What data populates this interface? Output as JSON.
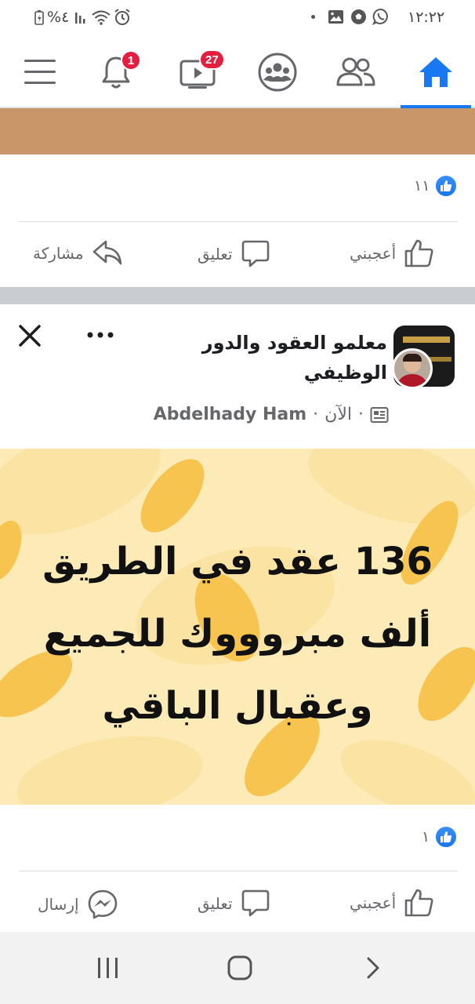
{
  "status_bar": {
    "time": "١٢:٢٢",
    "battery": "%٤",
    "icons": [
      "whatsapp-icon",
      "soccer-icon",
      "gallery-icon",
      "alarm-icon",
      "wifi-icon",
      "signal-icon",
      "battery-icon"
    ]
  },
  "nav": {
    "notifications_badge": "1",
    "video_badge": "27",
    "active_tab": "home",
    "accent": "#1877f2",
    "badge_color": "#e41e3f"
  },
  "post1": {
    "reaction_count": "١١",
    "actions": {
      "like": "أعجبني",
      "comment": "تعليق",
      "share": "مشاركة"
    }
  },
  "post2": {
    "page_name": "معلمو العقود والدور الوظيفي",
    "author": "Abdelhady Ham",
    "time": "الآن",
    "separator": "·",
    "image_text_lines": [
      "136 عقد في الطريق",
      "ألف مبروووك للجميع",
      "وعقبال الباقي"
    ],
    "reaction_count": "١",
    "actions": {
      "like": "أعجبني",
      "comment": "تعليق",
      "send": "إرسال"
    }
  }
}
